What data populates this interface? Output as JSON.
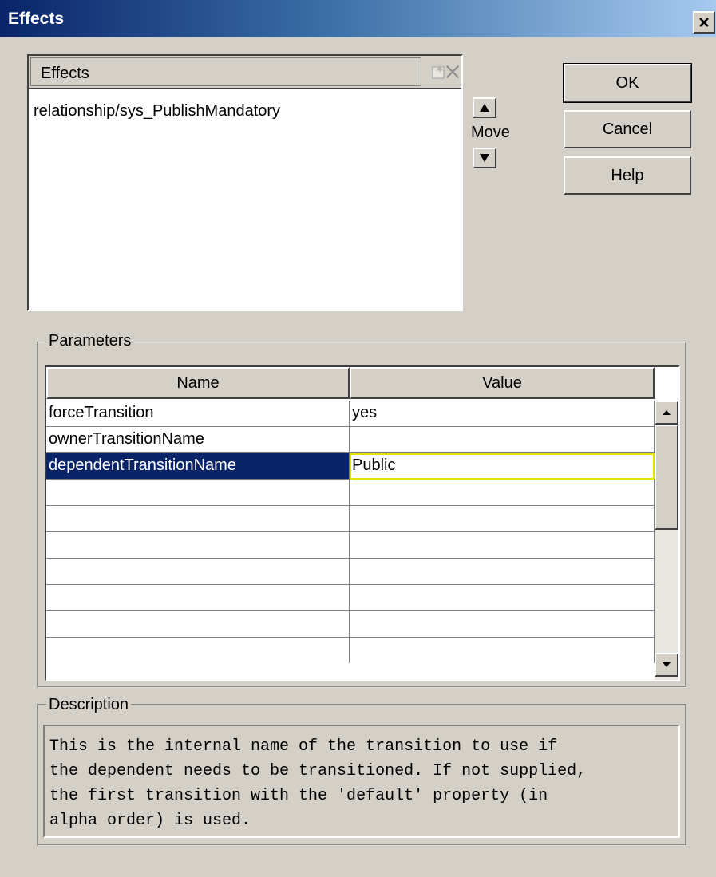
{
  "window": {
    "title": "Effects",
    "close_icon": "close-x-icon"
  },
  "effects_list": {
    "header_label": "Effects",
    "new_icon": "new-item-icon",
    "delete_icon": "delete-x-icon",
    "items": [
      "relationship/sys_PublishMandatory"
    ]
  },
  "move": {
    "label": "Move",
    "up_icon": "triangle-up-icon",
    "down_icon": "triangle-down-icon"
  },
  "buttons": {
    "ok": "OK",
    "cancel": "Cancel",
    "help": "Help"
  },
  "parameters": {
    "group_title": "Parameters",
    "columns": [
      "Name",
      "Value"
    ],
    "rows": [
      {
        "name": "forceTransition",
        "value": "yes"
      },
      {
        "name": "ownerTransitionName",
        "value": ""
      },
      {
        "name": "dependentTransitionName",
        "value": "Public"
      },
      {
        "name": "",
        "value": ""
      },
      {
        "name": "",
        "value": ""
      },
      {
        "name": "",
        "value": ""
      },
      {
        "name": "",
        "value": ""
      },
      {
        "name": "",
        "value": ""
      },
      {
        "name": "",
        "value": ""
      },
      {
        "name": "",
        "value": ""
      }
    ],
    "selected_row": 2
  },
  "description": {
    "group_title": "Description",
    "text": "This is the internal name of the transition to use if\nthe dependent needs to be transitioned. If not supplied,\nthe first transition with the 'default' property (in\nalpha order) is used."
  },
  "colors": {
    "selection": "#0a246a",
    "edit_outline": "#e4e000",
    "face": "#d4d0c8"
  }
}
